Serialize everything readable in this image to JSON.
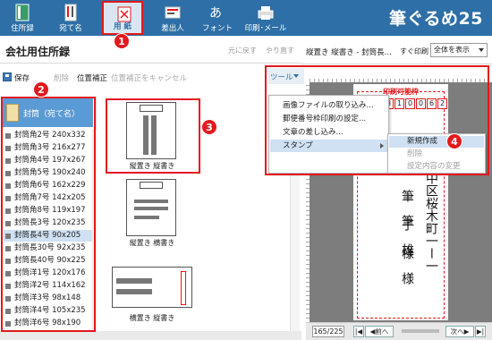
{
  "toolbar": {
    "items": [
      {
        "label": "住所録",
        "icon": "address-book-icon"
      },
      {
        "label": "宛て名",
        "icon": "recipient-card-icon"
      },
      {
        "label": "用 紙",
        "icon": "paper-icon",
        "selected": true
      },
      {
        "label": "差出人",
        "icon": "sender-icon"
      },
      {
        "label": "フォント",
        "icon": "font-icon"
      },
      {
        "label": "印刷･メール",
        "icon": "printer-icon"
      }
    ],
    "app_title": "筆ぐるめ25"
  },
  "header": {
    "title": "会社用住所録",
    "undo": "元に戻す",
    "redo": "やり直す"
  },
  "subbar": {
    "save": "保存",
    "delete": "削除",
    "position_fix": "位置補正",
    "cancel_position_fix": "位置補正をキャンセル"
  },
  "envelope_list": {
    "header": "封筒（宛て名）",
    "items": [
      {
        "name": "封筒角2号",
        "size": "240x332"
      },
      {
        "name": "封筒角3号",
        "size": "216x277"
      },
      {
        "name": "封筒角4号",
        "size": "197x267"
      },
      {
        "name": "封筒角5号",
        "size": "190x240"
      },
      {
        "name": "封筒角6号",
        "size": "162x229"
      },
      {
        "name": "封筒角7号",
        "size": "142x205"
      },
      {
        "name": "封筒角8号",
        "size": "119x197"
      },
      {
        "name": "封筒長3号",
        "size": "120x235"
      },
      {
        "name": "封筒長4号",
        "size": "90x205"
      },
      {
        "name": "封筒長30号",
        "size": "92x235"
      },
      {
        "name": "封筒長40号",
        "size": "90x225"
      },
      {
        "name": "封筒洋1号",
        "size": "120x176"
      },
      {
        "name": "封筒洋2号",
        "size": "114x162"
      },
      {
        "name": "封筒洋3号",
        "size": "98x148"
      },
      {
        "name": "封筒洋4号",
        "size": "105x235"
      },
      {
        "name": "封筒洋6号",
        "size": "98x190"
      }
    ],
    "selected_index": 8
  },
  "layouts": [
    {
      "label": "縦置き 縦書き"
    },
    {
      "label": "縦置き 横書き"
    },
    {
      "label": "横置き 縦書き"
    }
  ],
  "preview": {
    "title": "縦置き 縦書き - 封筒長...",
    "print_now": "すぐ印刷",
    "zoom": "全体を表示",
    "printable_area": "印刷可能枠",
    "zip_digits": [
      "2",
      "3",
      "1",
      "0",
      "0",
      "6",
      "2"
    ],
    "address": "浜市中区桜木町一ー一",
    "name_line1": "筆　筆",
    "name_line2": "子　雄",
    "honorific": "様　様",
    "page_indicator": "165/225",
    "prev": "◀前へ",
    "next": "次へ▶"
  },
  "tools_menu": {
    "label": "ツール",
    "items": [
      "画像ファイルの取り込み...",
      "郵便番号枠印刷の設定...",
      "文章の差し込み...",
      "スタンプ"
    ],
    "active_index": 3,
    "submenu": [
      {
        "label": "新規作成",
        "enabled": true
      },
      {
        "label": "削除",
        "enabled": false
      },
      {
        "label": "設定内容の変更",
        "enabled": false
      }
    ]
  },
  "markers": [
    "1",
    "2",
    "3",
    "4"
  ],
  "colors": {
    "toolbar_bg": "#2d6fa6",
    "highlight_red": "#e3191c",
    "selection_blue": "#cfe1f3",
    "list_header": "#5b9bd5"
  }
}
